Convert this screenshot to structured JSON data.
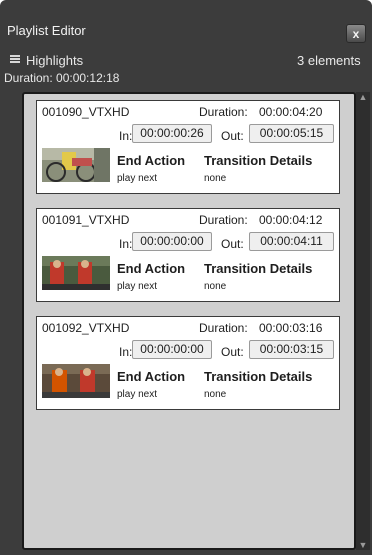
{
  "window": {
    "title": "Playlist Editor",
    "close_label": "x"
  },
  "playlist": {
    "name": "Highlights",
    "count": "3 elements",
    "duration": "Duration: 00:00:12:18"
  },
  "labels": {
    "duration": "Duration:",
    "in": "In:",
    "out": "Out:",
    "end_action": "End Action",
    "transition_details": "Transition Details"
  },
  "items": [
    {
      "name": "001090_VTXHD",
      "duration": "00:00:04:20",
      "in": "00:00:00:26",
      "out": "00:00:05:15",
      "end_action": "play next",
      "transition": "none"
    },
    {
      "name": "001091_VTXHD",
      "duration": "00:00:04:12",
      "in": "00:00:00:00",
      "out": "00:00:04:11",
      "end_action": "play next",
      "transition": "none"
    },
    {
      "name": "001092_VTXHD",
      "duration": "00:00:03:16",
      "in": "00:00:00:00",
      "out": "00:00:03:15",
      "end_action": "play next",
      "transition": "none"
    }
  ],
  "icons": {
    "list": "list-icon",
    "close": "close-icon",
    "scroll_up": "chevron-up-icon",
    "scroll_down": "chevron-down-icon"
  }
}
